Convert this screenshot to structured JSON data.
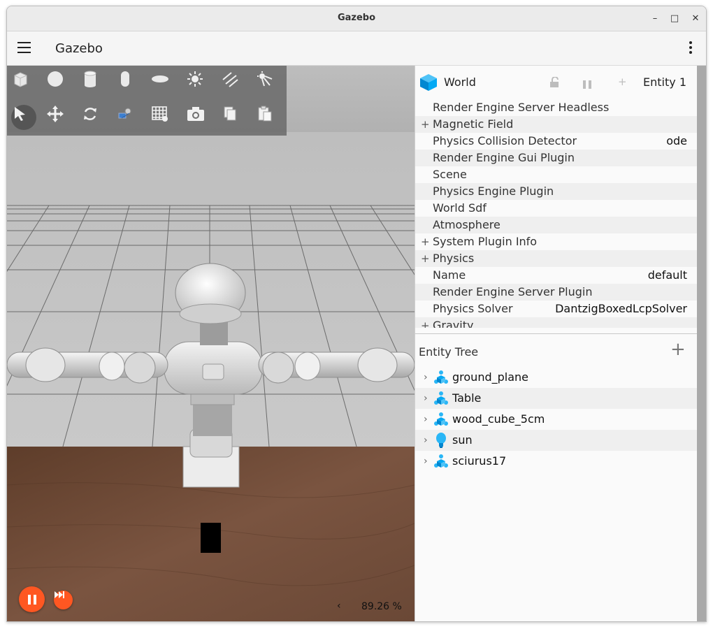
{
  "window": {
    "title": "Gazebo",
    "minimize": "–",
    "maximize": "□",
    "close": "✕"
  },
  "app": {
    "title": "Gazebo",
    "menu_icon": "hamburger-menu-icon",
    "more_icon": "kebab-menu-icon"
  },
  "toolbar": {
    "shapes": [
      {
        "name": "box-icon"
      },
      {
        "name": "sphere-icon"
      },
      {
        "name": "cylinder-icon"
      },
      {
        "name": "capsule-icon"
      },
      {
        "name": "ellipsoid-icon"
      },
      {
        "name": "point-light-icon"
      },
      {
        "name": "directional-light-icon"
      },
      {
        "name": "spot-light-icon"
      }
    ],
    "tools": [
      {
        "name": "select-icon",
        "selected": true
      },
      {
        "name": "translate-icon"
      },
      {
        "name": "rotate-icon"
      },
      {
        "name": "transform-control-icon"
      },
      {
        "name": "grid-snap-icon"
      },
      {
        "name": "screenshot-icon"
      },
      {
        "name": "copy-icon"
      },
      {
        "name": "paste-icon"
      }
    ]
  },
  "playback": {
    "rtf_value": "89.26 %",
    "rtf_arrow": "‹",
    "accent": "#ff5722"
  },
  "component_inspector": {
    "entity_name": "World",
    "entity_id_label": "Entity 1",
    "add_symbol": "+",
    "properties": [
      {
        "label": "Render Engine Server Headless",
        "value": "",
        "expandable": false
      },
      {
        "label": "Magnetic Field",
        "value": "",
        "expandable": true
      },
      {
        "label": "Physics Collision Detector",
        "value": "ode",
        "expandable": false
      },
      {
        "label": "Render Engine Gui Plugin",
        "value": "",
        "expandable": false
      },
      {
        "label": "Scene",
        "value": "",
        "expandable": false
      },
      {
        "label": "Physics Engine Plugin",
        "value": "",
        "expandable": false
      },
      {
        "label": "World Sdf",
        "value": "",
        "expandable": false
      },
      {
        "label": "Atmosphere",
        "value": "",
        "expandable": false
      },
      {
        "label": "System Plugin Info",
        "value": "",
        "expandable": true
      },
      {
        "label": "Physics",
        "value": "",
        "expandable": true
      },
      {
        "label": "Name",
        "value": "default",
        "expandable": false
      },
      {
        "label": "Render Engine Server Plugin",
        "value": "",
        "expandable": false
      },
      {
        "label": "Physics Solver",
        "value": "DantzigBoxedLcpSolver",
        "expandable": false
      },
      {
        "label": "Gravity",
        "value": "",
        "expandable": true
      }
    ],
    "expand_symbol": "+"
  },
  "entity_tree": {
    "title": "Entity Tree",
    "add_symbol": "+",
    "chevron": "›",
    "items": [
      {
        "name": "ground_plane",
        "icon": "model-icon"
      },
      {
        "name": "Table",
        "icon": "model-icon"
      },
      {
        "name": "wood_cube_5cm",
        "icon": "model-icon"
      },
      {
        "name": "sun",
        "icon": "light-icon"
      },
      {
        "name": "sciurus17",
        "icon": "model-icon"
      }
    ]
  },
  "colors": {
    "accent": "#ff5722",
    "model_icon": "#29b6f6",
    "table": "#6d4c35"
  }
}
